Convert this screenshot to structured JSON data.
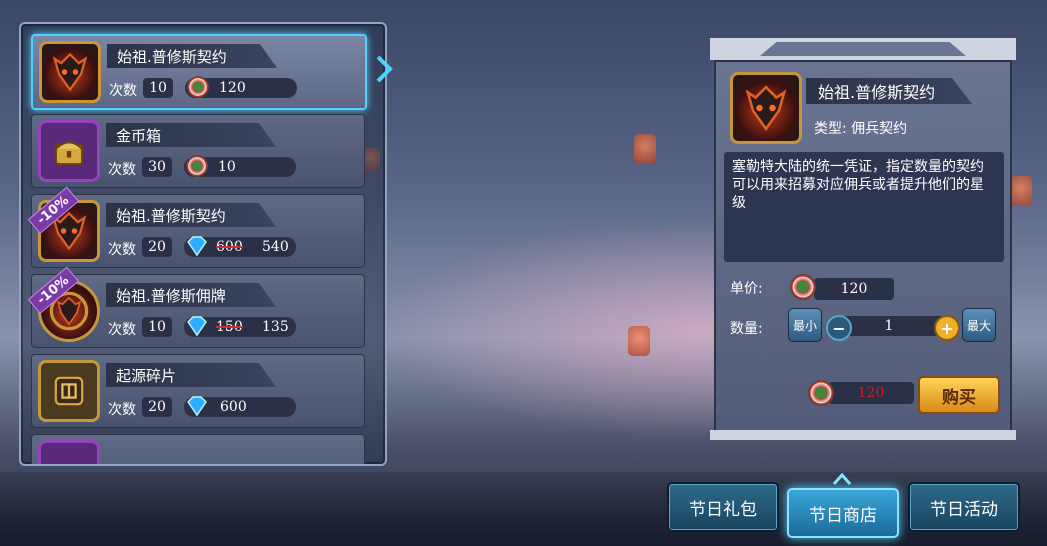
{
  "shop_list": [
    {
      "name": "始祖.普修斯契约",
      "count_label": "次数",
      "count": "10",
      "currency": "coin",
      "price": "120",
      "icon": "demon-contract-icon",
      "selected": true
    },
    {
      "name": "金币箱",
      "count_label": "次数",
      "count": "30",
      "currency": "coin",
      "price": "10",
      "icon": "gold-chest-icon"
    },
    {
      "name": "始祖.普修斯契约",
      "count_label": "次数",
      "count": "20",
      "currency": "gem",
      "old_price": "600",
      "price": "540",
      "discount": "-10%",
      "icon": "demon-contract-icon"
    },
    {
      "name": "始祖.普修斯佣牌",
      "count_label": "次数",
      "count": "10",
      "currency": "gem",
      "old_price": "150",
      "price": "135",
      "discount": "-10%",
      "icon": "demon-medal-icon"
    },
    {
      "name": "起源碎片",
      "count_label": "次数",
      "count": "20",
      "currency": "gem",
      "price": "600",
      "icon": "origin-fragment-icon"
    }
  ],
  "detail": {
    "name": "始祖.普修斯契约",
    "type": "类型:  佣兵契约",
    "description": "塞勒特大陆的统一凭证，指定数量的契约可以用来招募对应佣兵或者提升他们的星级",
    "unit_price_label": "单价:",
    "unit_price": "120",
    "quantity_label": "数量:",
    "min_label": "最小",
    "max_label": "最大",
    "quantity": "1",
    "total": "120",
    "buy_label": "购买"
  },
  "tabs": [
    {
      "label": "节日礼包",
      "active": false
    },
    {
      "label": "节日商店",
      "active": true
    },
    {
      "label": "节日活动",
      "active": false
    }
  ],
  "colors": {
    "highlight": "#4fd0ff",
    "buy": "#f2b43a",
    "discount": "#7a3aa8",
    "total_red": "#d02020"
  }
}
